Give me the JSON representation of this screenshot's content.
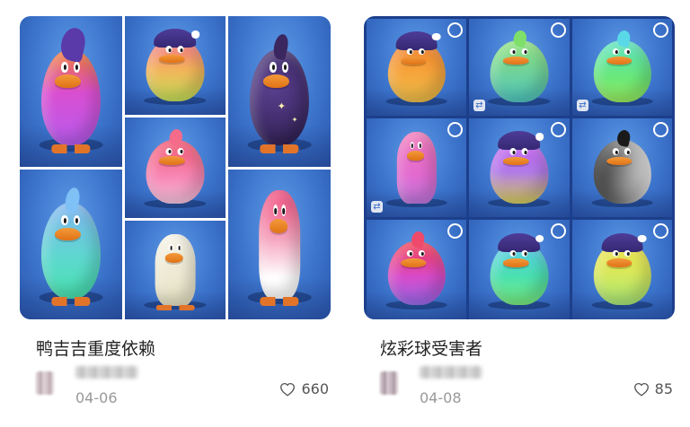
{
  "cards": [
    {
      "title": "鸭吉吉重度依赖",
      "date": "04-06",
      "likes": "660",
      "icons": {
        "like": "heart-outline-icon"
      }
    },
    {
      "title": "炫彩球受害者",
      "date": "04-08",
      "likes": "85",
      "icons": {
        "like": "heart-outline-icon",
        "select": "circle-select-icon",
        "swap": "swap-icon"
      }
    }
  ],
  "colors": {
    "title_text": "#222222",
    "date_text": "#999999",
    "likes_text": "#555555",
    "tile_blue": "#3c74cc",
    "grid_line_left": "#ffffff",
    "grid_line_right": "#1c3f8c"
  }
}
